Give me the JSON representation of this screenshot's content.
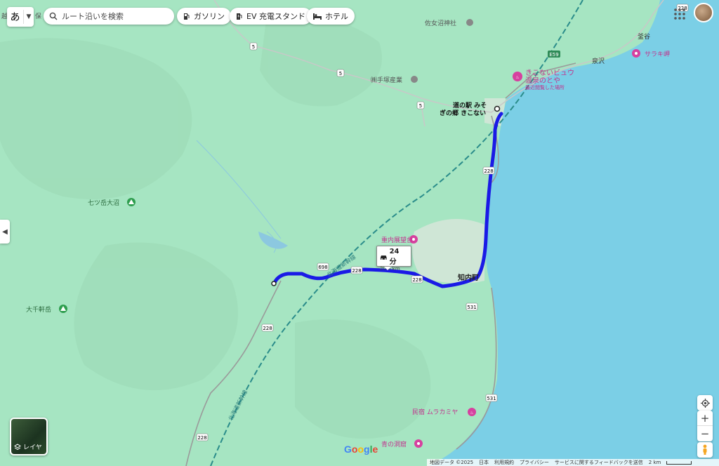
{
  "top_bar": {
    "lang_label": "あ",
    "search_placeholder": "ルート沿いを検索",
    "chips": [
      {
        "label": "ガソリン",
        "icon": "gas-station-icon"
      },
      {
        "label": "EV 充電スタンド",
        "icon": "ev-charger-icon"
      },
      {
        "label": "ホテル",
        "icon": "hotel-icon"
      }
    ]
  },
  "map": {
    "colors": {
      "land": "#a8e6c4",
      "sea": "#7dd0e6",
      "route": "#1a1ae6",
      "poi_pink": "#d6409f",
      "park_green": "#2e9e4e"
    },
    "labels": {
      "corner_text": "越",
      "corner_text2": "保",
      "sanuma_shrine": "佐女沼神社",
      "kamaya": "釜谷",
      "izumisawa": "泉沢",
      "sarakimisaki": "サラキ岬",
      "tezuka": "㈱手塚産業",
      "kikonai_view_1": "きこないビュウ",
      "kikonai_view_2": "温泉のとや",
      "kikonai_view_3": "最近閲覧した場所",
      "michinoeki_1": "道の駅 みそ",
      "michinoeki_2": "ぎの郷 きこない",
      "nanatsudake": "七ツ岳大沼",
      "shigenai": "重内展望台",
      "shiriuchi": "知内町",
      "daisengendake": "大千軒岳",
      "minshuku": "民宿 ムラカミヤ",
      "aono_dokutsu": "青の洞窟",
      "shinkansen_1": "北海道新幹線",
      "shinkansen_2": "北海道新幹線"
    },
    "road_shields": {
      "r228": "228",
      "r5": "5",
      "r698": "698",
      "r531": "531",
      "e59": "E59"
    },
    "route": {
      "duration": "24 分",
      "distance": "20.6 km"
    }
  },
  "controls": {
    "layer_label": "レイヤ",
    "google": "Google"
  },
  "footer": {
    "items": [
      "地図データ ©2025",
      "日本",
      "利用規約",
      "プライバシー",
      "サービスに関するフィードバックを送信"
    ],
    "scale": "2 km"
  }
}
